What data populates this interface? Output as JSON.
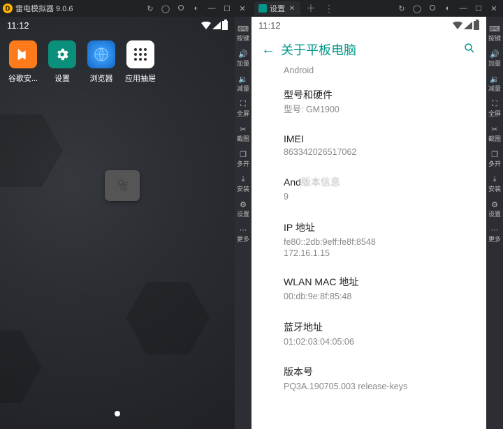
{
  "left": {
    "window_title": "雷电模拟器 9.0.6",
    "titlebar_icons": [
      "sync-icon",
      "user-icon",
      "lock-icon",
      "eye-icon",
      "minimize-icon",
      "maximize-icon",
      "close-icon"
    ],
    "clock": "11:12",
    "apps": [
      {
        "id": "play",
        "label": "谷歌安..."
      },
      {
        "id": "settings",
        "label": "设置"
      },
      {
        "id": "browser",
        "label": "浏览器"
      },
      {
        "id": "drawer",
        "label": "应用抽屉"
      }
    ]
  },
  "right": {
    "tab_title": "设置",
    "titlebar_icons": [
      "sync-icon",
      "user-icon",
      "lock-icon",
      "eye-icon",
      "minimize-icon",
      "maximize-icon",
      "close-icon"
    ],
    "clock": "11:12",
    "page_title": "关于平板电脑",
    "prev_section_sub": "Android",
    "rows": [
      {
        "title": "型号和硬件",
        "value": "型号: GM1900"
      },
      {
        "title": "IMEI",
        "value": "863342026517062"
      },
      {
        "title": "And",
        "title_blur": "版本信息",
        "value": "9",
        "value_blur": ""
      },
      {
        "title": "IP 地址",
        "value": "fe80::2db:9eff:fe8f:8548",
        "value2": "172.16.1.15"
      },
      {
        "title": "WLAN MAC 地址",
        "value": "00:db:9e:8f:85:48"
      },
      {
        "title": "蓝牙地址",
        "value": "01:02:03:04:05:06"
      },
      {
        "title": "版本号",
        "value": "PQ3A.190705.003 release-keys"
      }
    ]
  },
  "sidebar": [
    {
      "id": "keymap",
      "label": "按键",
      "glyph": "⌨"
    },
    {
      "id": "vol-up",
      "label": "加量",
      "glyph": "🔊"
    },
    {
      "id": "vol-down",
      "label": "减量",
      "glyph": "🔉"
    },
    {
      "id": "fullscreen",
      "label": "全屏",
      "glyph": "⛶"
    },
    {
      "id": "screenshot",
      "label": "截图",
      "glyph": "✂"
    },
    {
      "id": "multi",
      "label": "多开",
      "glyph": "❐"
    },
    {
      "id": "install",
      "label": "安装",
      "glyph": "⤓"
    },
    {
      "id": "setting",
      "label": "设置",
      "glyph": "⚙"
    },
    {
      "id": "more",
      "label": "更多",
      "glyph": "⋯"
    }
  ]
}
